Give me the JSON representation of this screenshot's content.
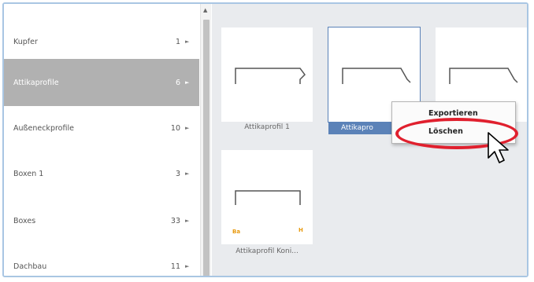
{
  "categories": [
    {
      "label": "Kupfer",
      "count": "1",
      "arrow": "►",
      "selected": false
    },
    {
      "label": "Attikaprofile",
      "count": "6",
      "arrow": "►",
      "selected": true
    },
    {
      "label": "Außeneckprofile",
      "count": "10",
      "arrow": "►",
      "selected": false
    },
    {
      "label": "Boxen 1",
      "count": "3",
      "arrow": "►",
      "selected": false
    },
    {
      "label": "Boxes",
      "count": "33",
      "arrow": "►",
      "selected": false
    },
    {
      "label": "Dachbau",
      "count": "11",
      "arrow": "►",
      "selected": false
    }
  ],
  "scrollbar": {
    "up_arrow": "▲"
  },
  "gallery": {
    "tiles": [
      {
        "caption": "Attikaprofil 1"
      },
      {
        "caption": "Attikapro"
      },
      {
        "caption": ""
      },
      {
        "caption": "Attikaprofil Koni...",
        "tag_left": "Ba",
        "tag_right": "H"
      }
    ]
  },
  "context_menu": {
    "items": [
      "Exportieren",
      "Löschen"
    ]
  },
  "colors": {
    "selection_gray": "#b1b1b1",
    "selection_blue": "#5b82b8",
    "highlight_ring": "#e0202e",
    "accent_orange": "#e89a10"
  }
}
